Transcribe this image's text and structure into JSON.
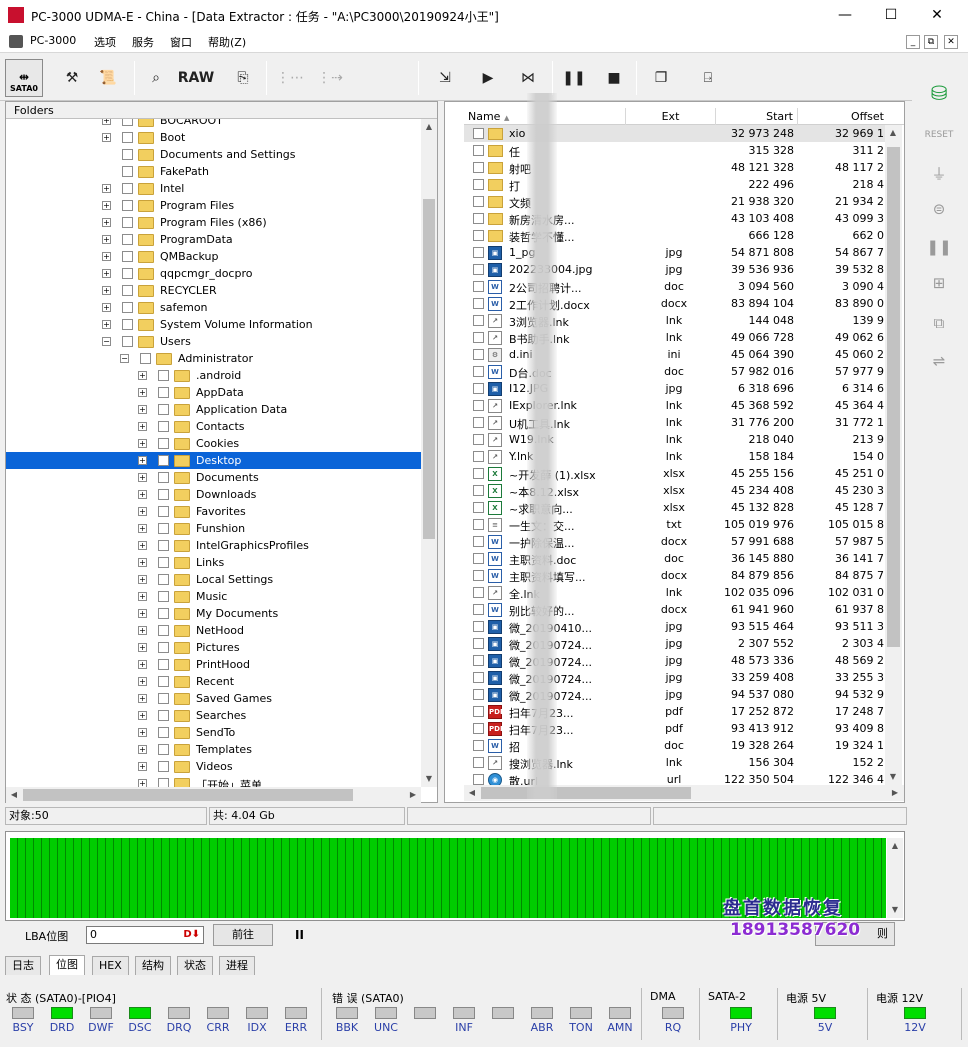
{
  "window": {
    "title": "PC-3000 UDMA-E - China - [Data Extractor : 任务 - \"A:\\PC3000\\20190924小王\"]",
    "minimize": "—",
    "maximize": "☐",
    "close": "✕"
  },
  "menu": {
    "items": [
      "PC-3000",
      "选项",
      "服务",
      "窗口",
      "帮助(Z)"
    ],
    "mdi": [
      "_",
      "⧉",
      "✕"
    ]
  },
  "toolbar": {
    "sata_label": "SATA0",
    "raw_label": "RAW"
  },
  "folders": {
    "header": "Folders",
    "items": [
      {
        "label": "BOCAROOT",
        "depth": 0,
        "expander": "+"
      },
      {
        "label": "Boot",
        "depth": 0,
        "expander": "+"
      },
      {
        "label": "Documents and Settings",
        "depth": 0,
        "expander": ""
      },
      {
        "label": "FakePath",
        "depth": 0,
        "expander": ""
      },
      {
        "label": "Intel",
        "depth": 0,
        "expander": "+"
      },
      {
        "label": "Program Files",
        "depth": 0,
        "expander": "+"
      },
      {
        "label": "Program Files (x86)",
        "depth": 0,
        "expander": "+"
      },
      {
        "label": "ProgramData",
        "depth": 0,
        "expander": "+"
      },
      {
        "label": "QMBackup",
        "depth": 0,
        "expander": "+"
      },
      {
        "label": "qqpcmgr_docpro",
        "depth": 0,
        "expander": "+"
      },
      {
        "label": "RECYCLER",
        "depth": 0,
        "expander": "+"
      },
      {
        "label": "safemon",
        "depth": 0,
        "expander": "+"
      },
      {
        "label": "System Volume Information",
        "depth": 0,
        "expander": "+"
      },
      {
        "label": "Users",
        "depth": 0,
        "expander": "−"
      },
      {
        "label": "Administrator",
        "depth": 1,
        "expander": "−"
      },
      {
        "label": ".android",
        "depth": 2,
        "expander": "+"
      },
      {
        "label": "AppData",
        "depth": 2,
        "expander": "+"
      },
      {
        "label": "Application Data",
        "depth": 2,
        "expander": "+"
      },
      {
        "label": "Contacts",
        "depth": 2,
        "expander": "+"
      },
      {
        "label": "Cookies",
        "depth": 2,
        "expander": "+"
      },
      {
        "label": "Desktop",
        "depth": 2,
        "expander": "+",
        "selected": true
      },
      {
        "label": "Documents",
        "depth": 2,
        "expander": "+"
      },
      {
        "label": "Downloads",
        "depth": 2,
        "expander": "+"
      },
      {
        "label": "Favorites",
        "depth": 2,
        "expander": "+"
      },
      {
        "label": "Funshion",
        "depth": 2,
        "expander": "+"
      },
      {
        "label": "IntelGraphicsProfiles",
        "depth": 2,
        "expander": "+"
      },
      {
        "label": "Links",
        "depth": 2,
        "expander": "+"
      },
      {
        "label": "Local Settings",
        "depth": 2,
        "expander": "+"
      },
      {
        "label": "Music",
        "depth": 2,
        "expander": "+"
      },
      {
        "label": "My Documents",
        "depth": 2,
        "expander": "+"
      },
      {
        "label": "NetHood",
        "depth": 2,
        "expander": "+"
      },
      {
        "label": "Pictures",
        "depth": 2,
        "expander": "+"
      },
      {
        "label": "PrintHood",
        "depth": 2,
        "expander": "+"
      },
      {
        "label": "Recent",
        "depth": 2,
        "expander": "+"
      },
      {
        "label": "Saved Games",
        "depth": 2,
        "expander": "+"
      },
      {
        "label": "Searches",
        "depth": 2,
        "expander": "+"
      },
      {
        "label": "SendTo",
        "depth": 2,
        "expander": "+"
      },
      {
        "label": "Templates",
        "depth": 2,
        "expander": "+"
      },
      {
        "label": "Videos",
        "depth": 2,
        "expander": "+"
      },
      {
        "label": "「开始」菜单",
        "depth": 2,
        "expander": "+"
      }
    ]
  },
  "files": {
    "columns": [
      "Name",
      "Ext",
      "Start",
      "Offset"
    ],
    "rows": [
      {
        "icon": "folder",
        "name": "xio",
        "ext": "",
        "start": "32 973 248",
        "offset": "32 969 1",
        "hl": true
      },
      {
        "icon": "folder",
        "name": "任",
        "ext": "",
        "start": "315 328",
        "offset": "311 2"
      },
      {
        "icon": "folder",
        "name": "射吧",
        "ext": "",
        "start": "48 121 328",
        "offset": "48 117 2"
      },
      {
        "icon": "folder",
        "name": "打",
        "ext": "",
        "start": "222 496",
        "offset": "218 4"
      },
      {
        "icon": "folder",
        "name": "文频",
        "ext": "",
        "start": "21 938 320",
        "offset": "21 934 2"
      },
      {
        "icon": "folder",
        "name": "新房清水房...",
        "ext": "",
        "start": "43 103 408",
        "offset": "43 099 3"
      },
      {
        "icon": "folder",
        "name": "装哲学不懂...",
        "ext": "",
        "start": "666 128",
        "offset": "662 0"
      },
      {
        "icon": "jpg",
        "name": "1_pg",
        "ext": "jpg",
        "start": "54 871 808",
        "offset": "54 867 7"
      },
      {
        "icon": "jpg",
        "name": "202233004.jpg",
        "ext": "jpg",
        "start": "39 536 936",
        "offset": "39 532 8"
      },
      {
        "icon": "doc",
        "name": "2公司招聘计...",
        "ext": "doc",
        "start": "3 094 560",
        "offset": "3 090 4"
      },
      {
        "icon": "doc",
        "name": "2工作计划.docx",
        "ext": "docx",
        "start": "83 894 104",
        "offset": "83 890 0"
      },
      {
        "icon": "lnk",
        "name": "3浏览器.lnk",
        "ext": "lnk",
        "start": "144 048",
        "offset": "139 9"
      },
      {
        "icon": "lnk",
        "name": "B书助手.lnk",
        "ext": "lnk",
        "start": "49 066 728",
        "offset": "49 062 6"
      },
      {
        "icon": "ini",
        "name": "d.ini",
        "ext": "ini",
        "start": "45 064 390",
        "offset": "45 060 2"
      },
      {
        "icon": "doc",
        "name": "D台.doc",
        "ext": "doc",
        "start": "57 982 016",
        "offset": "57 977 9"
      },
      {
        "icon": "jpg",
        "name": "I12.JPG",
        "ext": "jpg",
        "start": "6 318 696",
        "offset": "6 314 6"
      },
      {
        "icon": "lnk",
        "name": "IExplorer.lnk",
        "ext": "lnk",
        "start": "45 368 592",
        "offset": "45 364 4"
      },
      {
        "icon": "lnk",
        "name": "U机工具.lnk",
        "ext": "lnk",
        "start": "31 776 200",
        "offset": "31 772 1"
      },
      {
        "icon": "lnk",
        "name": "W19.lnk",
        "ext": "lnk",
        "start": "218 040",
        "offset": "213 9"
      },
      {
        "icon": "lnk",
        "name": "Y.lnk",
        "ext": "lnk",
        "start": "158 184",
        "offset": "154 0"
      },
      {
        "icon": "xlsx",
        "name": "~开发薛 (1).xlsx",
        "ext": "xlsx",
        "start": "45 255 156",
        "offset": "45 251 0"
      },
      {
        "icon": "xlsx",
        "name": "~本8.12.xlsx",
        "ext": "xlsx",
        "start": "45 234 408",
        "offset": "45 230 3"
      },
      {
        "icon": "xlsx",
        "name": "~求职意向...",
        "ext": "xlsx",
        "start": "45 132 828",
        "offset": "45 128 7"
      },
      {
        "icon": "txt",
        "name": "一生文：交...",
        "ext": "txt",
        "start": "105 019 976",
        "offset": "105 015 8"
      },
      {
        "icon": "doc",
        "name": "一护除保温...",
        "ext": "docx",
        "start": "57 991 688",
        "offset": "57 987 5"
      },
      {
        "icon": "doc",
        "name": "主职资料.doc",
        "ext": "doc",
        "start": "36 145 880",
        "offset": "36 141 7"
      },
      {
        "icon": "doc",
        "name": "主职资料填写...",
        "ext": "docx",
        "start": "84 879 856",
        "offset": "84 875 7"
      },
      {
        "icon": "lnk",
        "name": "全.lnk",
        "ext": "lnk",
        "start": "102 035 096",
        "offset": "102 031 0"
      },
      {
        "icon": "doc",
        "name": "别比较好的...",
        "ext": "docx",
        "start": "61 941 960",
        "offset": "61 937 8"
      },
      {
        "icon": "jpg",
        "name": "微_20190410...",
        "ext": "jpg",
        "start": "93 515 464",
        "offset": "93 511 3"
      },
      {
        "icon": "jpg",
        "name": "微_20190724...",
        "ext": "jpg",
        "start": "2 307 552",
        "offset": "2 303 4"
      },
      {
        "icon": "jpg",
        "name": "微_20190724...",
        "ext": "jpg",
        "start": "48 573 336",
        "offset": "48 569 2"
      },
      {
        "icon": "jpg",
        "name": "微_20190724...",
        "ext": "jpg",
        "start": "33 259 408",
        "offset": "33 255 3"
      },
      {
        "icon": "jpg",
        "name": "微_20190724...",
        "ext": "jpg",
        "start": "94 537 080",
        "offset": "94 532 9"
      },
      {
        "icon": "pdf",
        "name": "扫年7月23...",
        "ext": "pdf",
        "start": "17 252 872",
        "offset": "17 248 7"
      },
      {
        "icon": "pdf",
        "name": "扫年7月23...",
        "ext": "pdf",
        "start": "93 413 912",
        "offset": "93 409 8"
      },
      {
        "icon": "doc",
        "name": "招",
        "ext": "doc",
        "start": "19 328 264",
        "offset": "19 324 1"
      },
      {
        "icon": "lnk",
        "name": "搜浏览器.lnk",
        "ext": "lnk",
        "start": "156 304",
        "offset": "152 2"
      },
      {
        "icon": "url",
        "name": "散.url",
        "ext": "url",
        "start": "122 350 504",
        "offset": "122 346 4"
      }
    ]
  },
  "status": {
    "objects": "对象:50",
    "total": "共: 4.04 Gb"
  },
  "map": {
    "lba_label": "LBA位图",
    "lba_value": "0",
    "goto": "前往",
    "pause": "II",
    "right_btn": "则",
    "watermark_name": "盘首数据恢复",
    "watermark_phone": "18913587620"
  },
  "tabs": [
    "日志",
    "位图",
    "HEX",
    "结构",
    "状态",
    "进程"
  ],
  "leds": {
    "groups": [
      {
        "label": "状 态 (SATA0)-[PIO4]",
        "leds": [
          {
            "name": "BSY",
            "on": false
          },
          {
            "name": "DRD",
            "on": true
          },
          {
            "name": "DWF",
            "on": false
          },
          {
            "name": "DSC",
            "on": true
          },
          {
            "name": "DRQ",
            "on": false
          },
          {
            "name": "CRR",
            "on": false
          },
          {
            "name": "IDX",
            "on": false
          },
          {
            "name": "ERR",
            "on": false
          }
        ]
      },
      {
        "label": "错 误 (SATA0)",
        "leds": [
          {
            "name": "BBK",
            "on": false
          },
          {
            "name": "UNC",
            "on": false
          },
          {
            "name": "",
            "on": false
          },
          {
            "name": "INF",
            "on": false
          },
          {
            "name": "",
            "on": false
          },
          {
            "name": "ABR",
            "on": false
          },
          {
            "name": "TON",
            "on": false
          },
          {
            "name": "AMN",
            "on": false
          }
        ]
      },
      {
        "label": "DMA",
        "leds": [
          {
            "name": "RQ",
            "on": false
          }
        ]
      },
      {
        "label": "SATA-2",
        "leds": [
          {
            "name": "PHY",
            "on": true
          }
        ]
      },
      {
        "label": "电源 5V",
        "leds": [
          {
            "name": "5V",
            "on": true
          }
        ]
      },
      {
        "label": "电源 12V",
        "leds": [
          {
            "name": "12V",
            "on": true
          }
        ]
      }
    ]
  }
}
